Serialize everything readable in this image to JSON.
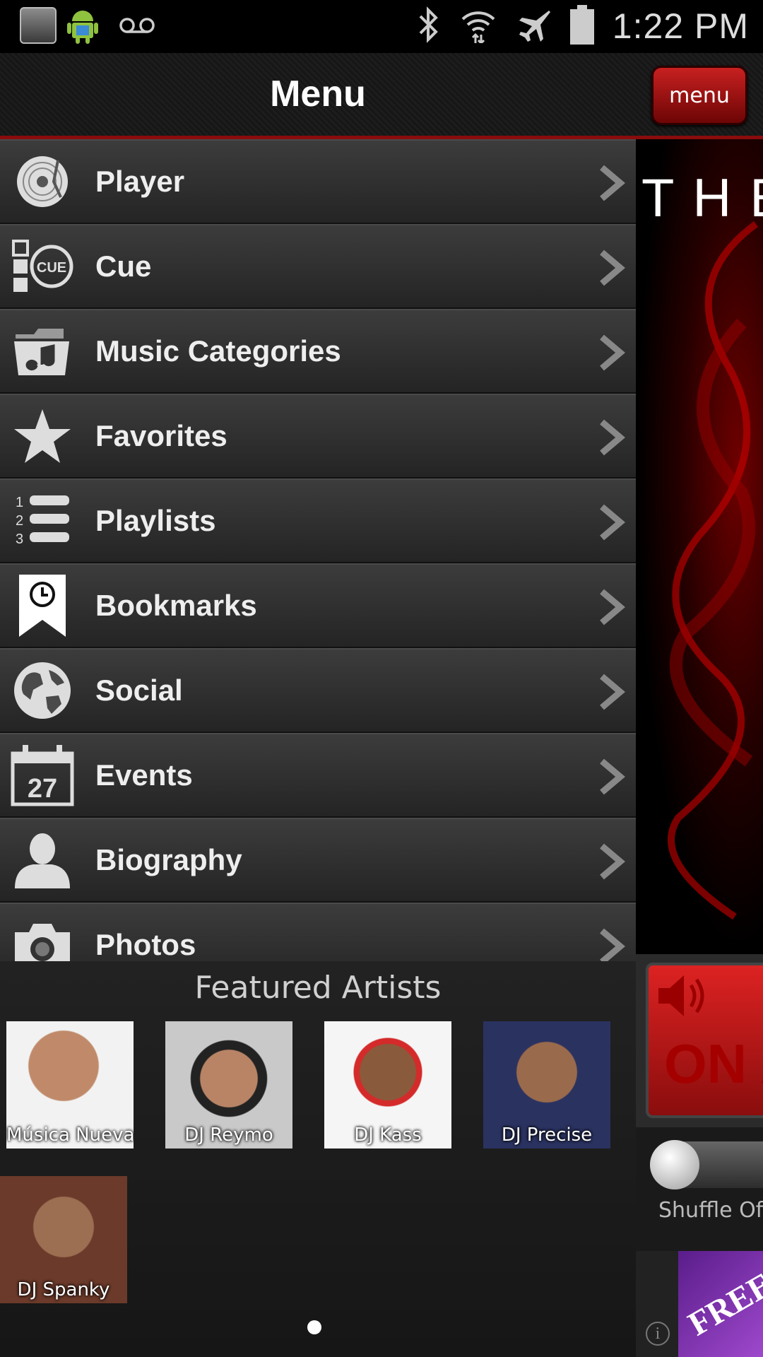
{
  "status_bar": {
    "time": "1:22 PM",
    "icons": [
      "app-notification-icon",
      "android-icon",
      "voicemail-icon",
      "bluetooth-icon",
      "wifi-icon",
      "airplane-icon",
      "battery-icon"
    ]
  },
  "header": {
    "title": "Menu",
    "menu_button_label": "menu"
  },
  "menu": {
    "items": [
      {
        "label": "Player",
        "icon": "vinyl-record-icon"
      },
      {
        "label": "Cue",
        "icon": "cue-icon"
      },
      {
        "label": "Music Categories",
        "icon": "music-folder-icon"
      },
      {
        "label": "Favorites",
        "icon": "star-icon"
      },
      {
        "label": "Playlists",
        "icon": "numbered-list-icon"
      },
      {
        "label": "Bookmarks",
        "icon": "bookmark-clock-icon"
      },
      {
        "label": "Social",
        "icon": "globe-icon"
      },
      {
        "label": "Events",
        "icon": "calendar-icon",
        "calendar_day": "27"
      },
      {
        "label": "Biography",
        "icon": "person-icon"
      },
      {
        "label": "Photos",
        "icon": "camera-icon"
      }
    ]
  },
  "featured": {
    "title": "Featured Artists",
    "artists": [
      {
        "name": "Música Nueva"
      },
      {
        "name": "DJ Reymo"
      },
      {
        "name": "DJ Kass"
      },
      {
        "name": "DJ Precise"
      },
      {
        "name": "DJ Spanky"
      }
    ]
  },
  "side_panel": {
    "title_fragment": "THE",
    "on_air_text": "ON AIR",
    "shuffle_label": "Shuffle Of",
    "ad_text": "FREE",
    "ad_info": "i"
  },
  "colors": {
    "accent_red": "#8a0c0c",
    "menu_button": "#b01818"
  }
}
